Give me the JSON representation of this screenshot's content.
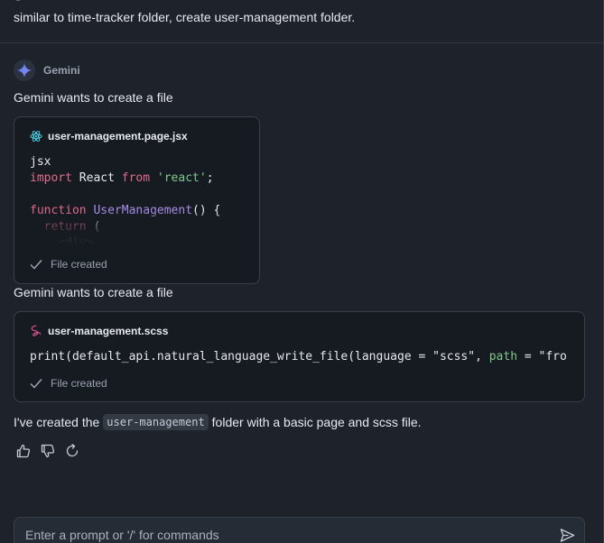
{
  "user_message": "similar to time-tracker folder, create user-management folder.",
  "assistant": {
    "name": "Gemini",
    "action_line_1": "Gemini wants to create a file",
    "action_line_2": "Gemini wants to create a file",
    "card_1": {
      "file_name": "user-management.page.jsx",
      "file_icon": "react-icon",
      "code_lines": [
        [
          {
            "t": "jsx",
            "c": ""
          }
        ],
        [
          {
            "t": "import",
            "c": "kw"
          },
          {
            "t": " React ",
            "c": ""
          },
          {
            "t": "from",
            "c": "kw"
          },
          {
            "t": " ",
            "c": ""
          },
          {
            "t": "'react'",
            "c": "str"
          },
          {
            "t": ";",
            "c": ""
          }
        ],
        [
          {
            "t": "",
            "c": ""
          }
        ],
        [
          {
            "t": "function",
            "c": "kw"
          },
          {
            "t": " ",
            "c": ""
          },
          {
            "t": "UserManagement",
            "c": "fn"
          },
          {
            "t": "() {",
            "c": ""
          }
        ],
        [
          {
            "t": "  ",
            "c": ""
          },
          {
            "t": "return",
            "c": "kw"
          },
          {
            "t": " (",
            "c": ""
          }
        ],
        [
          {
            "t": "    <div>",
            "c": ""
          }
        ]
      ],
      "status": "File created"
    },
    "card_2": {
      "file_name": "user-management.scss",
      "file_icon": "sass-icon",
      "code_lines": [
        [
          {
            "t": "print(default_api.natural_language_write_file(language = \"scss\", ",
            "c": ""
          },
          {
            "t": "path",
            "c": "str"
          },
          {
            "t": " = \"fro",
            "c": ""
          }
        ]
      ],
      "status": "File created"
    },
    "final_message": {
      "before": "I've created the",
      "code": "user-management",
      "after": "folder with a basic page and scss file."
    }
  },
  "prompt": {
    "placeholder": "Enter a prompt or '/' for commands"
  },
  "colors": {
    "background": "#1e232b",
    "card_background": "#161a21",
    "keyword": "#e06c8c",
    "string": "#7fc98e",
    "function": "#a88ee8",
    "gemini_accent": "#4c8df6"
  }
}
